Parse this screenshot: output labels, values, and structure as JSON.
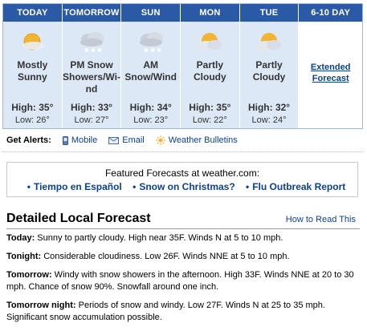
{
  "forecast": [
    {
      "day": "TODAY",
      "condition_line1": "Mostly",
      "condition_line2": "Sunny",
      "condition_line3": "",
      "high": "High: 35°",
      "low": "Low: 26°",
      "icon": "sun-cloud-icon"
    },
    {
      "day": "TOMORROW",
      "condition_line1": "PM Snow",
      "condition_line2": "Showers/Wi-",
      "condition_line3": "nd",
      "high": "High: 33°",
      "low": "Low: 27°",
      "icon": "snow-cloud-icon"
    },
    {
      "day": "SUN",
      "condition_line1": "AM",
      "condition_line2": "Snow/Wind",
      "condition_line3": "",
      "high": "High: 34°",
      "low": "Low: 23°",
      "icon": "snow-cloud-icon"
    },
    {
      "day": "MON",
      "condition_line1": "Partly",
      "condition_line2": "Cloudy",
      "condition_line3": "",
      "high": "High: 35°",
      "low": "Low: 22°",
      "icon": "sun-cloud-icon"
    },
    {
      "day": "TUE",
      "condition_line1": "Partly",
      "condition_line2": "Cloudy",
      "condition_line3": "",
      "high": "High: 32°",
      "low": "Low: 24°",
      "icon": "sun-cloud-icon"
    }
  ],
  "extended": {
    "day": "6-10 DAY",
    "line1": "Extended",
    "line2": "Forecast"
  },
  "alerts": {
    "label": "Get Alerts:",
    "mobile": "Mobile",
    "email": "Email",
    "bulletins": "Weather Bulletins"
  },
  "featured": {
    "title": "Featured Forecasts at weather.com:",
    "links": [
      "Tiempo en Español",
      "Snow on Christmas?",
      "Flu Outbreak Report"
    ]
  },
  "detailed": {
    "title": "Detailed Local Forecast",
    "howto": "How to Read This",
    "items": [
      {
        "label": "Today:",
        "text": " Sunny to partly cloudy. High near 35F. Winds N at 5 to 10 mph."
      },
      {
        "label": "Tonight:",
        "text": " Considerable cloudiness. Low 26F. Winds NNE at 5 to 10 mph."
      },
      {
        "label": "Tomorrow:",
        "text": " Windy with snow showers in the afternoon. High 33F. Winds NNE at 20 to 30 mph. Chance of snow 90%. Snowfall around one inch."
      },
      {
        "label": "Tomorrow night:",
        "text": " Periods of snow and windy. Low 27F. Winds N at 25 to 35 mph. Significant snow accumulation possible."
      }
    ]
  },
  "colors": {
    "header_bg": "#2a5aa6",
    "cell_bg": "#dde8f7",
    "link": "#0b3f94"
  }
}
